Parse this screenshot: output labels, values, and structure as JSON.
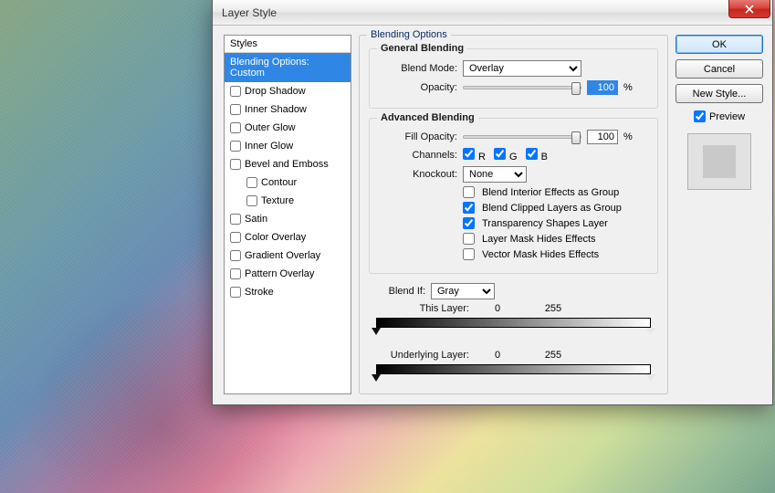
{
  "window": {
    "title": "Layer Style"
  },
  "styles": {
    "header": "Styles",
    "items": [
      {
        "label": "Blending Options: Custom",
        "checked": null
      },
      {
        "label": "Drop Shadow",
        "checked": false
      },
      {
        "label": "Inner Shadow",
        "checked": false
      },
      {
        "label": "Outer Glow",
        "checked": false
      },
      {
        "label": "Inner Glow",
        "checked": false
      },
      {
        "label": "Bevel and Emboss",
        "checked": false
      },
      {
        "label": "Contour",
        "checked": false
      },
      {
        "label": "Texture",
        "checked": false
      },
      {
        "label": "Satin",
        "checked": false
      },
      {
        "label": "Color Overlay",
        "checked": false
      },
      {
        "label": "Gradient Overlay",
        "checked": false
      },
      {
        "label": "Pattern Overlay",
        "checked": false
      },
      {
        "label": "Stroke",
        "checked": false
      }
    ]
  },
  "blending": {
    "section_title": "Blending Options",
    "general": {
      "title": "General Blending",
      "blend_mode_label": "Blend Mode:",
      "blend_mode_value": "Overlay",
      "opacity_label": "Opacity:",
      "opacity_value": "100",
      "opacity_unit": "%"
    },
    "advanced": {
      "title": "Advanced Blending",
      "fill_opacity_label": "Fill Opacity:",
      "fill_opacity_value": "100",
      "fill_opacity_unit": "%",
      "channels_label": "Channels:",
      "channels": {
        "R": true,
        "G": true,
        "B": true
      },
      "channel_R_label": "R",
      "channel_G_label": "G",
      "channel_B_label": "B",
      "knockout_label": "Knockout:",
      "knockout_value": "None",
      "opts": {
        "interior": {
          "label": "Blend Interior Effects as Group",
          "checked": false
        },
        "clipped": {
          "label": "Blend Clipped Layers as Group",
          "checked": true
        },
        "transparency": {
          "label": "Transparency Shapes Layer",
          "checked": true
        },
        "layermask": {
          "label": "Layer Mask Hides Effects",
          "checked": false
        },
        "vectormask": {
          "label": "Vector Mask Hides Effects",
          "checked": false
        }
      }
    },
    "blendif": {
      "label": "Blend If:",
      "channel": "Gray",
      "this_layer_label": "This Layer:",
      "underlying_label": "Underlying Layer:",
      "this_low": "0",
      "this_high": "255",
      "under_low": "0",
      "under_high": "255"
    }
  },
  "buttons": {
    "ok": "OK",
    "cancel": "Cancel",
    "new_style": "New Style..."
  },
  "preview": {
    "label": "Preview",
    "checked": true
  }
}
